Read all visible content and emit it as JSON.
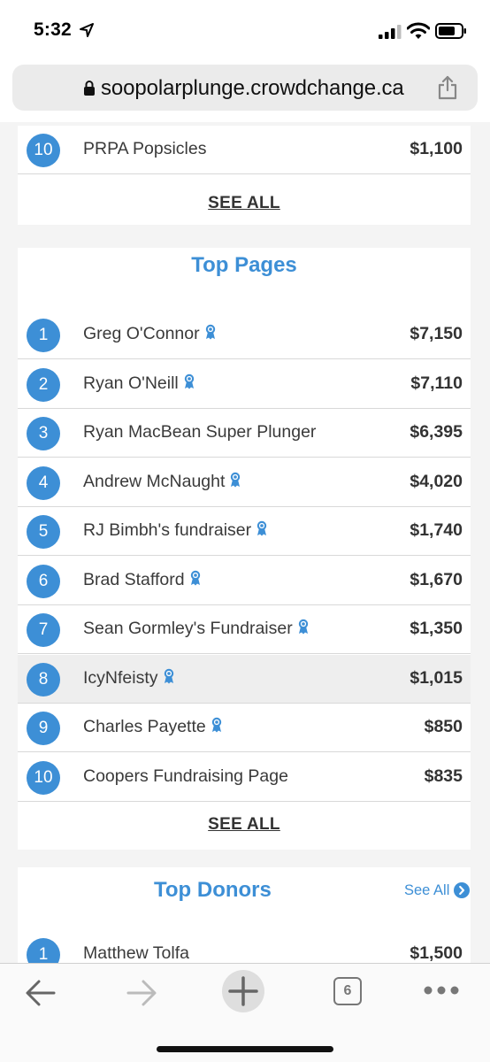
{
  "status_bar": {
    "time": "5:32"
  },
  "browser": {
    "url": "soopolarplunge.crowdchange.ca",
    "tab_count": "6"
  },
  "top_teams_tail": {
    "rows": [
      {
        "rank": "10",
        "name": "PRPA Popsicles",
        "amount": "$1,100"
      }
    ],
    "see_all": "SEE ALL"
  },
  "top_pages": {
    "title": "Top Pages",
    "rows": [
      {
        "rank": "1",
        "name": "Greg O'Connor",
        "amount": "$7,150"
      },
      {
        "rank": "2",
        "name": "Ryan O'Neill",
        "amount": "$7,110"
      },
      {
        "rank": "3",
        "name": "Ryan MacBean Super Plunger",
        "amount": "$6,395"
      },
      {
        "rank": "4",
        "name": "Andrew McNaught",
        "amount": "$4,020"
      },
      {
        "rank": "5",
        "name": "RJ Bimbh's fundraiser",
        "amount": "$1,740"
      },
      {
        "rank": "6",
        "name": "Brad Stafford",
        "amount": "$1,670"
      },
      {
        "rank": "7",
        "name": "Sean Gormley's Fundraiser",
        "amount": "$1,350"
      },
      {
        "rank": "8",
        "name": "IcyNfeisty",
        "amount": "$1,015"
      },
      {
        "rank": "9",
        "name": "Charles Payette",
        "amount": "$850"
      },
      {
        "rank": "10",
        "name": "Coopers Fundraising Page",
        "amount": "$835"
      }
    ],
    "see_all": "SEE ALL"
  },
  "top_donors": {
    "title": "Top Donors",
    "see_all": "See All",
    "rows": [
      {
        "rank": "1",
        "name": "Matthew Tolfa",
        "amount": "$1,500"
      }
    ]
  },
  "colors": {
    "accent": "#3d8fd6",
    "text": "#3a3a3a",
    "divider": "#d8d8d8"
  },
  "icons": {
    "ribbon": "award-ribbon-icon",
    "lock": "lock-icon",
    "share": "share-icon",
    "back": "back-arrow-icon",
    "forward": "forward-arrow-icon",
    "new_tab": "plus-icon",
    "more": "more-icon"
  }
}
